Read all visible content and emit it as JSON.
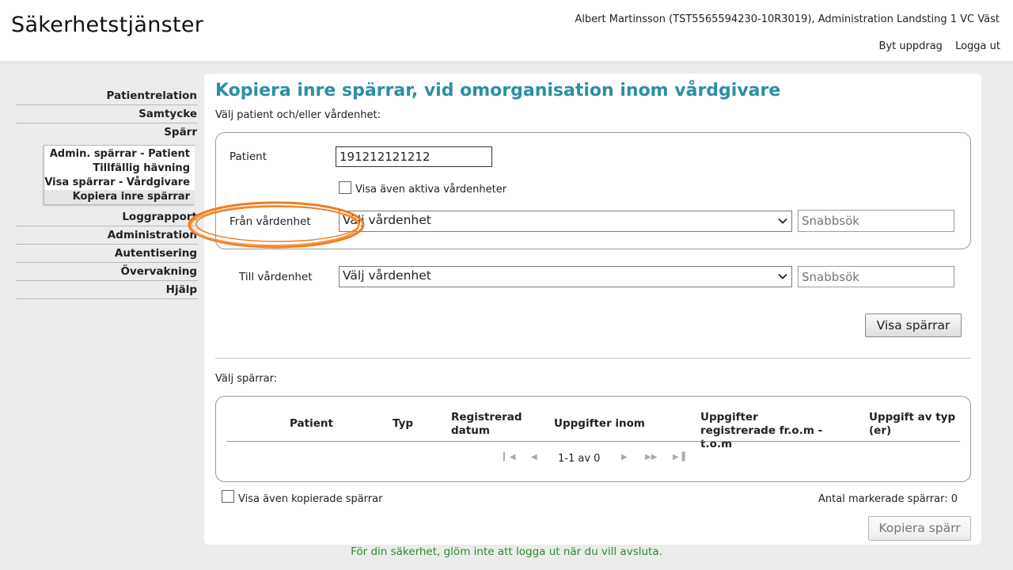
{
  "app": {
    "title": "Säkerhetstjänster",
    "user": "Albert Martinsson (TST5565594230-10R3019), Administration Landsting 1 VC Väst",
    "links": [
      "Byt uppdrag",
      "Logga ut"
    ]
  },
  "sidebar": {
    "top_items": [
      "Patientrelation",
      "Samtycke",
      "Spärr"
    ],
    "sub_items": [
      "Admin. spärrar - Patient",
      "Tillfällig hävning",
      "Visa spärrar - Vårdgivare",
      "Kopiera inre spärrar"
    ],
    "active_sub": "Kopiera inre spärrar",
    "bottom_items": [
      "Loggrapport",
      "Administration",
      "Autentisering",
      "Övervakning",
      "Hjälp"
    ]
  },
  "main": {
    "title": "Kopiera inre spärrar, vid omorganisation inom vårdgivare",
    "subhead": "Välj patient och/eller vårdenhet:",
    "patient_label": "Patient",
    "patient_value": "191212121212",
    "show_active_label": "Visa även aktiva vårdenheter",
    "from_label": "Från vårdenhet",
    "from_select": "Välj vårdenhet",
    "from_search_placeholder": "Snabbsök",
    "to_label": "Till vårdenhet",
    "to_select": "Välj vårdenhet",
    "to_search_placeholder": "Snabbsök",
    "show_button": "Visa spärrar",
    "choose_blocks": "Välj spärrar:",
    "table_headers": [
      "Patient",
      "Typ",
      "Registrerad datum",
      "Uppgifter inom",
      "Uppgifter registrerade fr.o.m - t.o.m",
      "Uppgift av typ (er)"
    ],
    "pager_text": "1-1 av 0",
    "show_copied_label": "Visa även kopierade spärrar",
    "marked_count_label": "Antal markerade spärrar: 0",
    "copy_button": "Kopiera spärr"
  },
  "footer": "För din säkerhet, glöm inte att logga ut när du vill avsluta.",
  "colors": {
    "title": "#2c8fa5",
    "footer": "#2e8b2e",
    "highlight": "#f07d1e"
  }
}
